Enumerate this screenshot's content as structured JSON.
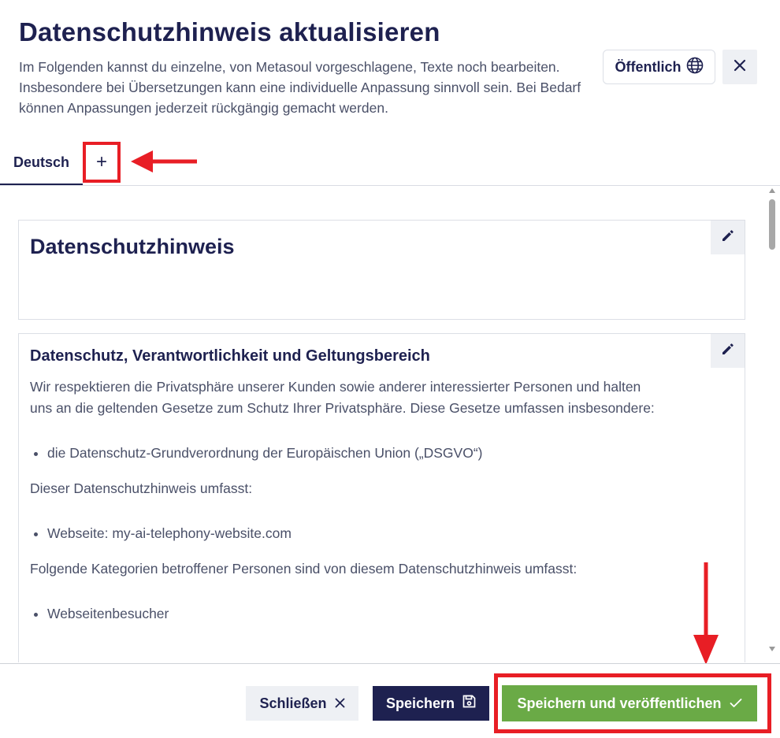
{
  "header": {
    "title": "Datenschutzhinweis aktualisieren",
    "description": "Im Folgenden kannst du einzelne, von Metasoul vorgeschlagene, Texte noch bearbeiten. Insbesondere bei Übersetzungen kann eine individuelle Anpassung sinnvoll sein. Bei Bedarf können Anpassungen jederzeit rückgängig gemacht werden.",
    "visibility_label": "Öffentlich"
  },
  "tabs": {
    "items": [
      {
        "label": "Deutsch",
        "active": true
      }
    ],
    "add_label": "+"
  },
  "cards": [
    {
      "heading": "Datenschutzhinweis"
    },
    {
      "heading": "Datenschutz, Verantwortlichkeit und Geltungsbereich",
      "paragraph_1": "Wir respektieren die Privatsphäre unserer Kunden sowie anderer interessierter Personen und halten uns an die geltenden Gesetze zum Schutz Ihrer Privatsphäre. Diese Gesetze umfassen insbesondere:",
      "list_1": [
        "die Datenschutz-Grundverordnung der Europäischen Union („DSGVO“)"
      ],
      "paragraph_2": "Dieser Datenschutzhinweis umfasst:",
      "list_2": [
        "Webseite: my-ai-telephony-website.com"
      ],
      "paragraph_3": "Folgende Kategorien betroffener Personen sind von diesem Datenschutzhinweis umfasst:",
      "list_3": [
        "Webseitenbesucher"
      ]
    }
  ],
  "footer": {
    "close_label": "Schließen",
    "save_label": "Speichern",
    "publish_label": "Speichern und veröffentlichen"
  },
  "colors": {
    "primary": "#1e2150",
    "success": "#6aaa46",
    "annotation": "#e81e25",
    "muted_bg": "#eef0f4"
  },
  "icons": [
    "globe-icon",
    "close-icon",
    "plus-icon",
    "pencil-icon",
    "save-icon",
    "check-icon"
  ]
}
